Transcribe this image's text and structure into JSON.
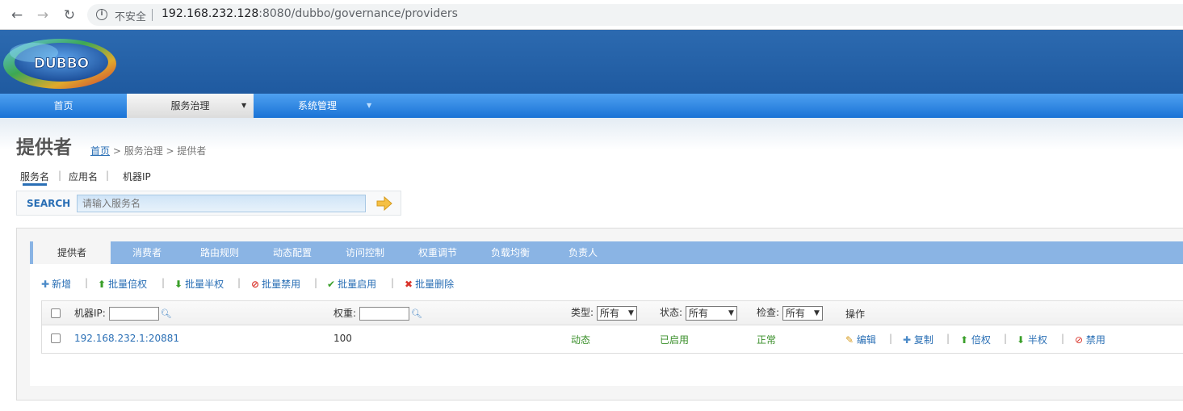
{
  "browser": {
    "back": "←",
    "forward": "→",
    "reload": "↻",
    "info": "i",
    "insecure": "不安全",
    "url_host": "192.168.232.128",
    "url_rest": ":8080/dubbo/governance/providers"
  },
  "logo": {
    "text": "DUBBO"
  },
  "menu": {
    "home": "首页",
    "governance": "服务治理",
    "system": "系统管理",
    "arrow": "▼"
  },
  "page": {
    "title": "提供者",
    "breadcrumb_home": "首页",
    "breadcrumb_rest": " > 服务治理 > 提供者"
  },
  "search": {
    "tabs": [
      "服务名",
      "应用名",
      "机器IP"
    ],
    "separator": "|",
    "label": "SEARCH",
    "placeholder": "请输入服务名"
  },
  "tabs": [
    "提供者",
    "消费者",
    "路由规则",
    "动态配置",
    "访问控制",
    "权重调节",
    "负载均衡",
    "负责人"
  ],
  "toolbar": {
    "add": "新增",
    "double_weight": "批量倍权",
    "half_weight": "批量半权",
    "disable": "批量禁用",
    "enable": "批量启用",
    "delete": "批量删除",
    "separator": "|"
  },
  "table": {
    "headers": {
      "ip": "机器IP:",
      "weight": "权重:",
      "type": "类型:",
      "status": "状态:",
      "check": "检查:",
      "ops": "操作",
      "all": "所有"
    },
    "rows": [
      {
        "address": "192.168.232.1:20881",
        "weight": "100",
        "type": "动态",
        "status": "已启用",
        "check": "正常",
        "ops": [
          "编辑",
          "复制",
          "倍权",
          "半权",
          "禁用"
        ]
      }
    ]
  },
  "colors": {
    "header_blue": "#1f5aa0",
    "menu_blue": "#1a73d6",
    "tab_blue": "#8ab4e4",
    "link": "#2a6fb5",
    "ok_green": "#3a8f2a"
  }
}
